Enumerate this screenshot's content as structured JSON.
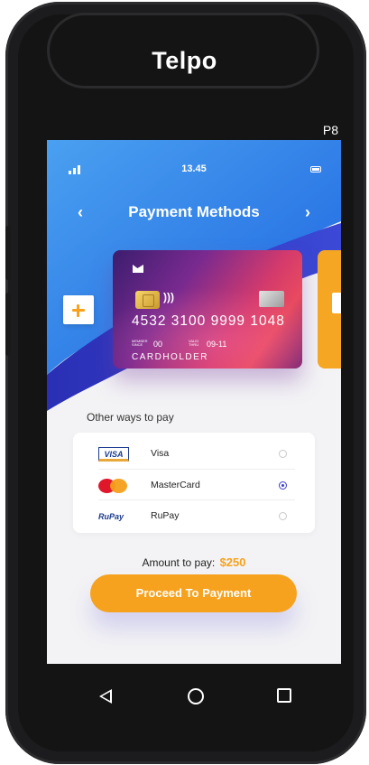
{
  "device": {
    "brand": "Telpo",
    "model": "P8"
  },
  "status_bar": {
    "time": "13.45"
  },
  "header": {
    "title": "Payment Methods",
    "back_icon": "chevron-left-icon",
    "forward_icon": "chevron-right-icon"
  },
  "card": {
    "number": "4532  3100  9999  1048",
    "member_since_label": "MEMBER SINCE",
    "member_since": "00",
    "valid_thru_label": "VALID THRU",
    "valid_thru": "09-11",
    "holder": "CARDHOLDER"
  },
  "other_ways": {
    "title": "Other ways to pay",
    "methods": [
      {
        "name": "Visa",
        "logo_text": "VISA",
        "selected": false
      },
      {
        "name": "MasterCard",
        "logo_text": "MasterCard",
        "selected": true
      },
      {
        "name": "RuPay",
        "logo_text": "RuPay",
        "selected": false
      }
    ]
  },
  "amount": {
    "label": "Amount to pay:",
    "value": "$250"
  },
  "proceed_button": {
    "label": "Proceed To Payment"
  },
  "colors": {
    "accent": "#f6a21e",
    "blue": "#1f5fe0",
    "radio_checked": "#3b3bd0"
  }
}
